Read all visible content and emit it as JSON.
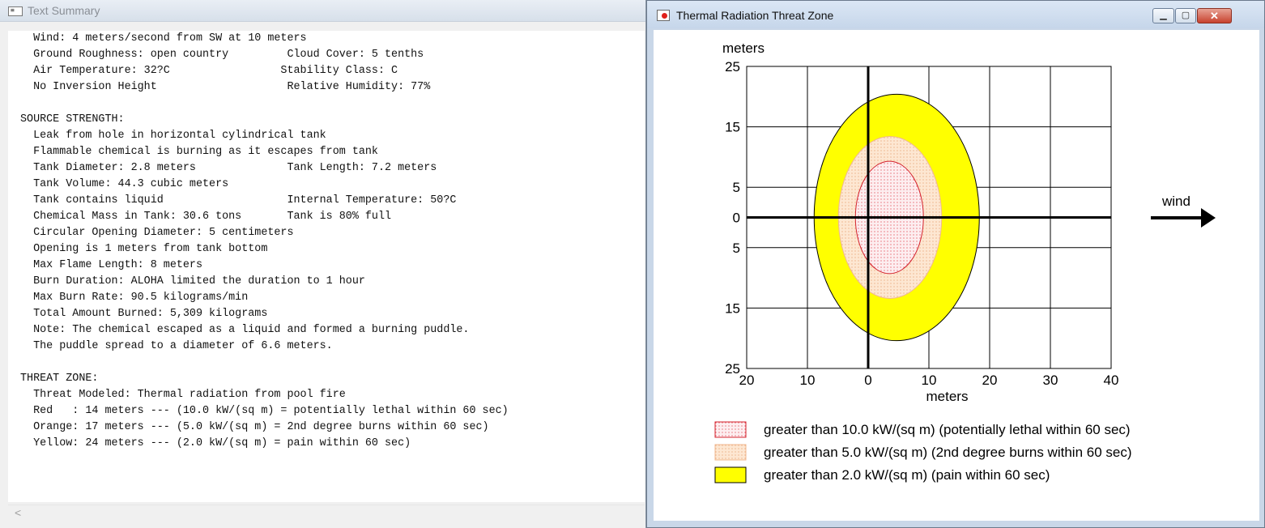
{
  "left_window": {
    "title": "Text Summary",
    "lines": [
      "  Wind: 4 meters/second from SW at 10 meters",
      "  Ground Roughness: open country         Cloud Cover: 5 tenths",
      "  Air Temperature: 32?C                 Stability Class: C",
      "  No Inversion Height                    Relative Humidity: 77%",
      "",
      "SOURCE STRENGTH:",
      "  Leak from hole in horizontal cylindrical tank",
      "  Flammable chemical is burning as it escapes from tank",
      "  Tank Diameter: 2.8 meters              Tank Length: 7.2 meters",
      "  Tank Volume: 44.3 cubic meters",
      "  Tank contains liquid                   Internal Temperature: 50?C",
      "  Chemical Mass in Tank: 30.6 tons       Tank is 80% full",
      "  Circular Opening Diameter: 5 centimeters",
      "  Opening is 1 meters from tank bottom",
      "  Max Flame Length: 8 meters",
      "  Burn Duration: ALOHA limited the duration to 1 hour",
      "  Max Burn Rate: 90.5 kilograms/min",
      "  Total Amount Burned: 5,309 kilograms",
      "  Note: The chemical escaped as a liquid and formed a burning puddle.",
      "  The puddle spread to a diameter of 6.6 meters.",
      "",
      "THREAT ZONE:",
      "  Threat Modeled: Thermal radiation from pool fire",
      "  Red   : 14 meters --- (10.0 kW/(sq m) = potentially lethal within 60 sec)",
      "  Orange: 17 meters --- (5.0 kW/(sq m) = 2nd degree burns within 60 sec)",
      "  Yellow: 24 meters --- (2.0 kW/(sq m) = pain within 60 sec)"
    ],
    "scroll_left_icon": "chevron-left-icon"
  },
  "right_window": {
    "title": "Thermal Radiation Threat Zone",
    "buttons": {
      "minimize": "min-icon",
      "maximize": "max-icon",
      "close": "close-icon"
    },
    "wind_label": "wind",
    "x_axis_label": "meters",
    "y_axis_label": "meters",
    "x_ticks": [
      "20",
      "10",
      "0",
      "10",
      "20",
      "30",
      "40"
    ],
    "y_ticks": [
      "25",
      "15",
      "5",
      "0",
      "5",
      "15",
      "25"
    ],
    "legend": [
      {
        "color": "#e8303a",
        "label": "greater than 10.0 kW/(sq m) (potentially lethal within 60 sec)"
      },
      {
        "color": "#f5c9a3",
        "label": "greater than 5.0 kW/(sq m) (2nd degree burns within 60 sec)"
      },
      {
        "color": "#ffff00",
        "label": "greater than 2.0 kW/(sq m) (pain within 60 sec)"
      }
    ]
  },
  "chart_data": {
    "type": "area",
    "xlabel": "meters",
    "ylabel": "meters",
    "xlim": [
      -20,
      40
    ],
    "ylim": [
      -25,
      25
    ],
    "grid": true,
    "zones": [
      {
        "name": "greater than 10.0 kW/(sq m) (potentially lethal within 60 sec)",
        "color": "#e8303a",
        "center_x": 3.5,
        "center_y": 0,
        "radius_x": 5.6,
        "radius_y": 9.3
      },
      {
        "name": "greater than 5.0 kW/(sq m) (2nd degree burns within 60 sec)",
        "color": "#f5c9a3",
        "center_x": 3.6,
        "center_y": 0,
        "radius_x": 8.5,
        "radius_y": 13.4
      },
      {
        "name": "greater than 2.0 kW/(sq m) (pain within 60 sec)",
        "color": "#ffff00",
        "center_x": 4.7,
        "center_y": 0,
        "radius_x": 13.6,
        "radius_y": 20.4
      }
    ]
  }
}
